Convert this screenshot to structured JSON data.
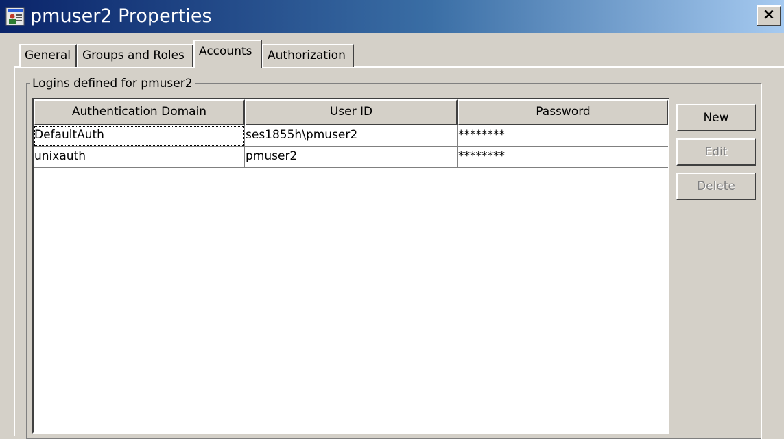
{
  "window": {
    "title": "pmuser2 Properties",
    "close_label": "×"
  },
  "tabs": [
    {
      "label": "General",
      "active": false
    },
    {
      "label": "Groups and Roles",
      "active": false
    },
    {
      "label": "Accounts",
      "active": true
    },
    {
      "label": "Authorization",
      "active": false
    }
  ],
  "group": {
    "label": "Logins defined for pmuser2"
  },
  "table": {
    "columns": [
      "Authentication Domain",
      "User ID",
      "Password"
    ],
    "rows": [
      [
        "DefaultAuth",
        "ses1855h\\pmuser2",
        "********"
      ],
      [
        "unixauth",
        "pmuser2",
        "********"
      ]
    ]
  },
  "buttons": {
    "new": "New",
    "edit": "Edit",
    "delete": "Delete"
  },
  "icons": {
    "app": "user-properties-icon",
    "close": "close-icon"
  }
}
